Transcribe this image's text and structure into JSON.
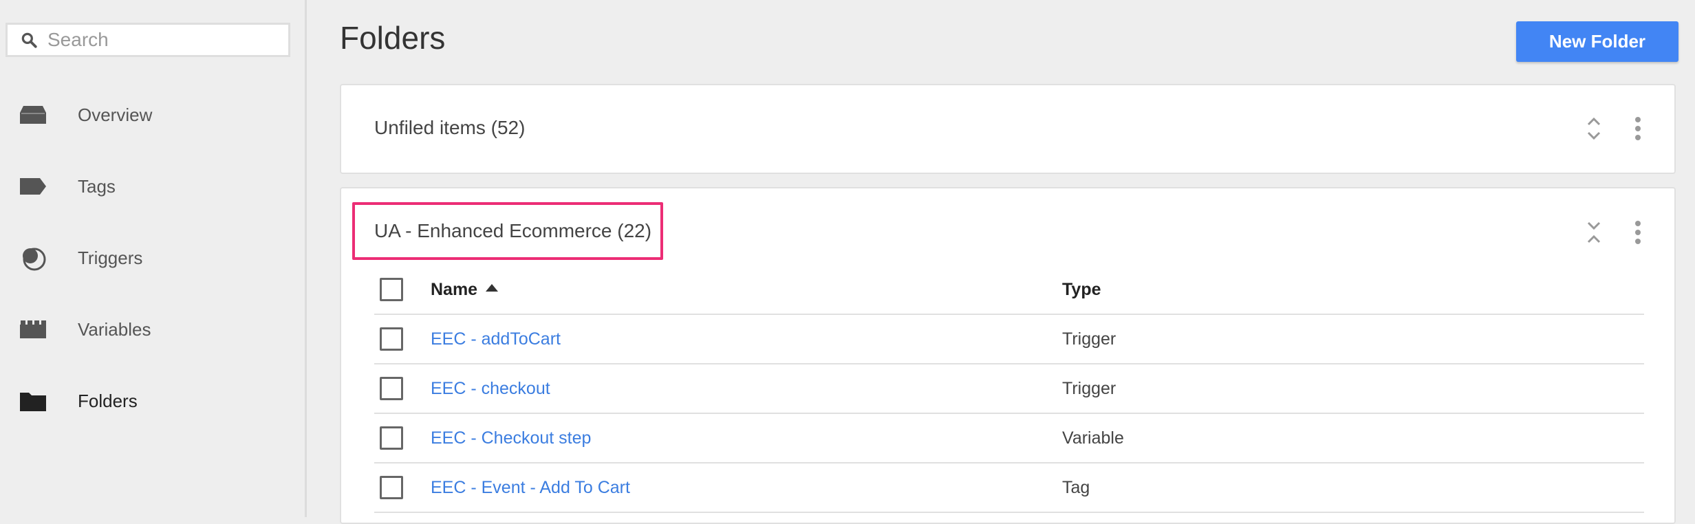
{
  "sidebar": {
    "search_placeholder": "Search",
    "items": [
      {
        "label": "Overview",
        "icon": "inbox-icon"
      },
      {
        "label": "Tags",
        "icon": "tag-icon"
      },
      {
        "label": "Triggers",
        "icon": "trigger-icon"
      },
      {
        "label": "Variables",
        "icon": "variables-icon"
      },
      {
        "label": "Folders",
        "icon": "folder-icon",
        "active": true
      }
    ]
  },
  "header": {
    "title": "Folders",
    "new_folder_label": "New Folder"
  },
  "folders": [
    {
      "title": "Unfiled items (52)",
      "expanded": false
    },
    {
      "title": "UA - Enhanced Ecommerce (22)",
      "expanded": true,
      "highlight_color": "#ec2d75",
      "table": {
        "headers": {
          "name": "Name",
          "type": "Type"
        },
        "rows": [
          {
            "name": "EEC - addToCart",
            "type": "Trigger"
          },
          {
            "name": "EEC - checkout",
            "type": "Trigger"
          },
          {
            "name": "EEC - Checkout step",
            "type": "Variable"
          },
          {
            "name": "EEC - Event - Add To Cart",
            "type": "Tag"
          }
        ]
      }
    }
  ],
  "colors": {
    "accent": "#4285f4",
    "link": "#3b7de0",
    "highlight": "#ec2d75"
  }
}
